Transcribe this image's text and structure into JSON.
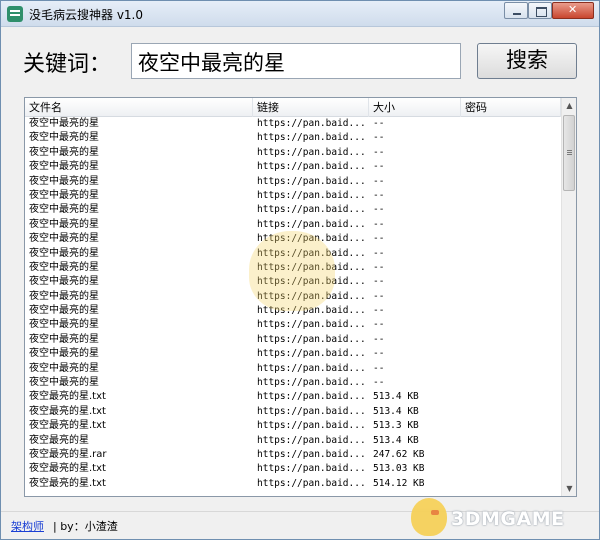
{
  "window": {
    "title": "没毛病云搜神器 v1.0"
  },
  "search": {
    "label": "关键词：",
    "value": "夜空中最亮的星",
    "button_label": "搜索"
  },
  "table": {
    "columns": [
      "文件名",
      "链接",
      "大小",
      "密码"
    ],
    "rows": [
      {
        "name": "夜空中最亮的星",
        "link": "https://pan.baid...",
        "size": "--",
        "password": ""
      },
      {
        "name": "夜空中最亮的星",
        "link": "https://pan.baid...",
        "size": "--",
        "password": ""
      },
      {
        "name": "夜空中最亮的星",
        "link": "https://pan.baid...",
        "size": "--",
        "password": ""
      },
      {
        "name": "夜空中最亮的星",
        "link": "https://pan.baid...",
        "size": "--",
        "password": ""
      },
      {
        "name": "夜空中最亮的星",
        "link": "https://pan.baid...",
        "size": "--",
        "password": ""
      },
      {
        "name": "夜空中最亮的星",
        "link": "https://pan.baid...",
        "size": "--",
        "password": ""
      },
      {
        "name": "夜空中最亮的星",
        "link": "https://pan.baid...",
        "size": "--",
        "password": ""
      },
      {
        "name": "夜空中最亮的星",
        "link": "https://pan.baid...",
        "size": "--",
        "password": ""
      },
      {
        "name": "夜空中最亮的星",
        "link": "https://pan.baid...",
        "size": "--",
        "password": ""
      },
      {
        "name": "夜空中最亮的星",
        "link": "https://pan.baid...",
        "size": "--",
        "password": ""
      },
      {
        "name": "夜空中最亮的星",
        "link": "https://pan.baid...",
        "size": "--",
        "password": ""
      },
      {
        "name": "夜空中最亮的星",
        "link": "https://pan.baid...",
        "size": "--",
        "password": ""
      },
      {
        "name": "夜空中最亮的星",
        "link": "https://pan.baid...",
        "size": "--",
        "password": ""
      },
      {
        "name": "夜空中最亮的星",
        "link": "https://pan.baid...",
        "size": "--",
        "password": ""
      },
      {
        "name": "夜空中最亮的星",
        "link": "https://pan.baid...",
        "size": "--",
        "password": ""
      },
      {
        "name": "夜空中最亮的星",
        "link": "https://pan.baid...",
        "size": "--",
        "password": ""
      },
      {
        "name": "夜空中最亮的星",
        "link": "https://pan.baid...",
        "size": "--",
        "password": ""
      },
      {
        "name": "夜空中最亮的星",
        "link": "https://pan.baid...",
        "size": "--",
        "password": ""
      },
      {
        "name": "夜空中最亮的星",
        "link": "https://pan.baid...",
        "size": "--",
        "password": ""
      },
      {
        "name": "夜空最亮的星.txt",
        "link": "https://pan.baid...",
        "size": "513.4 KB",
        "password": ""
      },
      {
        "name": "夜空最亮的星.txt",
        "link": "https://pan.baid...",
        "size": "513.4 KB",
        "password": ""
      },
      {
        "name": "夜空最亮的星.txt",
        "link": "https://pan.baid...",
        "size": "513.3 KB",
        "password": ""
      },
      {
        "name": "夜空最亮的星",
        "link": "https://pan.baid...",
        "size": "513.4 KB",
        "password": ""
      },
      {
        "name": "夜空最亮的星.rar",
        "link": "https://pan.baid...",
        "size": "247.62 KB",
        "password": ""
      },
      {
        "name": "夜空最亮的星.txt",
        "link": "https://pan.baid...",
        "size": "513.03 KB",
        "password": ""
      },
      {
        "name": "夜空最亮的星.txt",
        "link": "https://pan.baid...",
        "size": "514.12 KB",
        "password": ""
      }
    ]
  },
  "status": {
    "link_text": "架构师",
    "credit_text": "| by：小渣渣"
  },
  "watermark": {
    "text": "3DMGAME"
  },
  "colors": {
    "link": "#1a3fd4",
    "window_border": "#6f8fb0",
    "close_button": "#c9462f"
  }
}
